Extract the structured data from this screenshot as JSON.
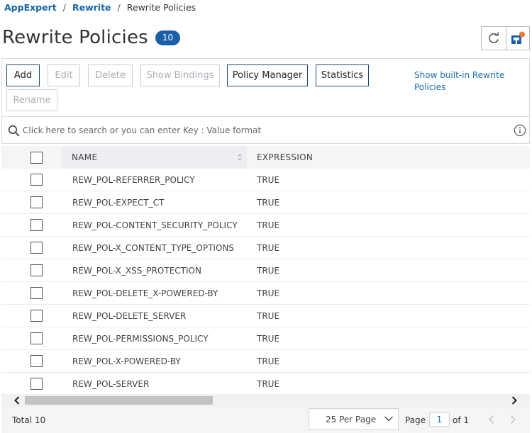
{
  "breadcrumb": {
    "root": "AppExpert",
    "parent": "Rewrite",
    "current": "Rewrite Policies",
    "separator": "/"
  },
  "header": {
    "title": "Rewrite Policies",
    "count": "10",
    "icons": [
      "refresh-icon",
      "config-cart-icon"
    ],
    "accent_color": "#1b5fa8",
    "notification_color": "#f07b2d"
  },
  "toolbar": {
    "add": "Add",
    "edit": "Edit",
    "delete": "Delete",
    "show_bindings": "Show Bindings",
    "policy_manager": "Policy Manager",
    "statistics": "Statistics",
    "rename": "Rename",
    "show_builtin": "Show built-in Rewrite Policies"
  },
  "search": {
    "placeholder": "Click here to search or you can enter Key : Value format"
  },
  "table": {
    "columns": [
      "NAME",
      "EXPRESSION"
    ],
    "rows": [
      {
        "name": "REW_POL-REFERRER_POLICY",
        "expression": "TRUE"
      },
      {
        "name": "REW_POL-EXPECT_CT",
        "expression": "TRUE"
      },
      {
        "name": "REW_POL-CONTENT_SECURITY_POLICY",
        "expression": "TRUE"
      },
      {
        "name": "REW_POL-X_CONTENT_TYPE_OPTIONS",
        "expression": "TRUE"
      },
      {
        "name": "REW_POL-X_XSS_PROTECTION",
        "expression": "TRUE"
      },
      {
        "name": "REW_POL-DELETE_X-POWERED-BY",
        "expression": "TRUE"
      },
      {
        "name": "REW_POL-DELETE_SERVER",
        "expression": "TRUE"
      },
      {
        "name": "REW_POL-PERMISSIONS_POLICY",
        "expression": "TRUE"
      },
      {
        "name": "REW_POL-X-POWERED-BY",
        "expression": "TRUE"
      },
      {
        "name": "REW_POL-SERVER",
        "expression": "TRUE"
      }
    ]
  },
  "footer": {
    "total": "Total 10",
    "per_page": "25 Per Page",
    "page_label": "Page",
    "page_value": "1",
    "of_label": "of 1"
  }
}
